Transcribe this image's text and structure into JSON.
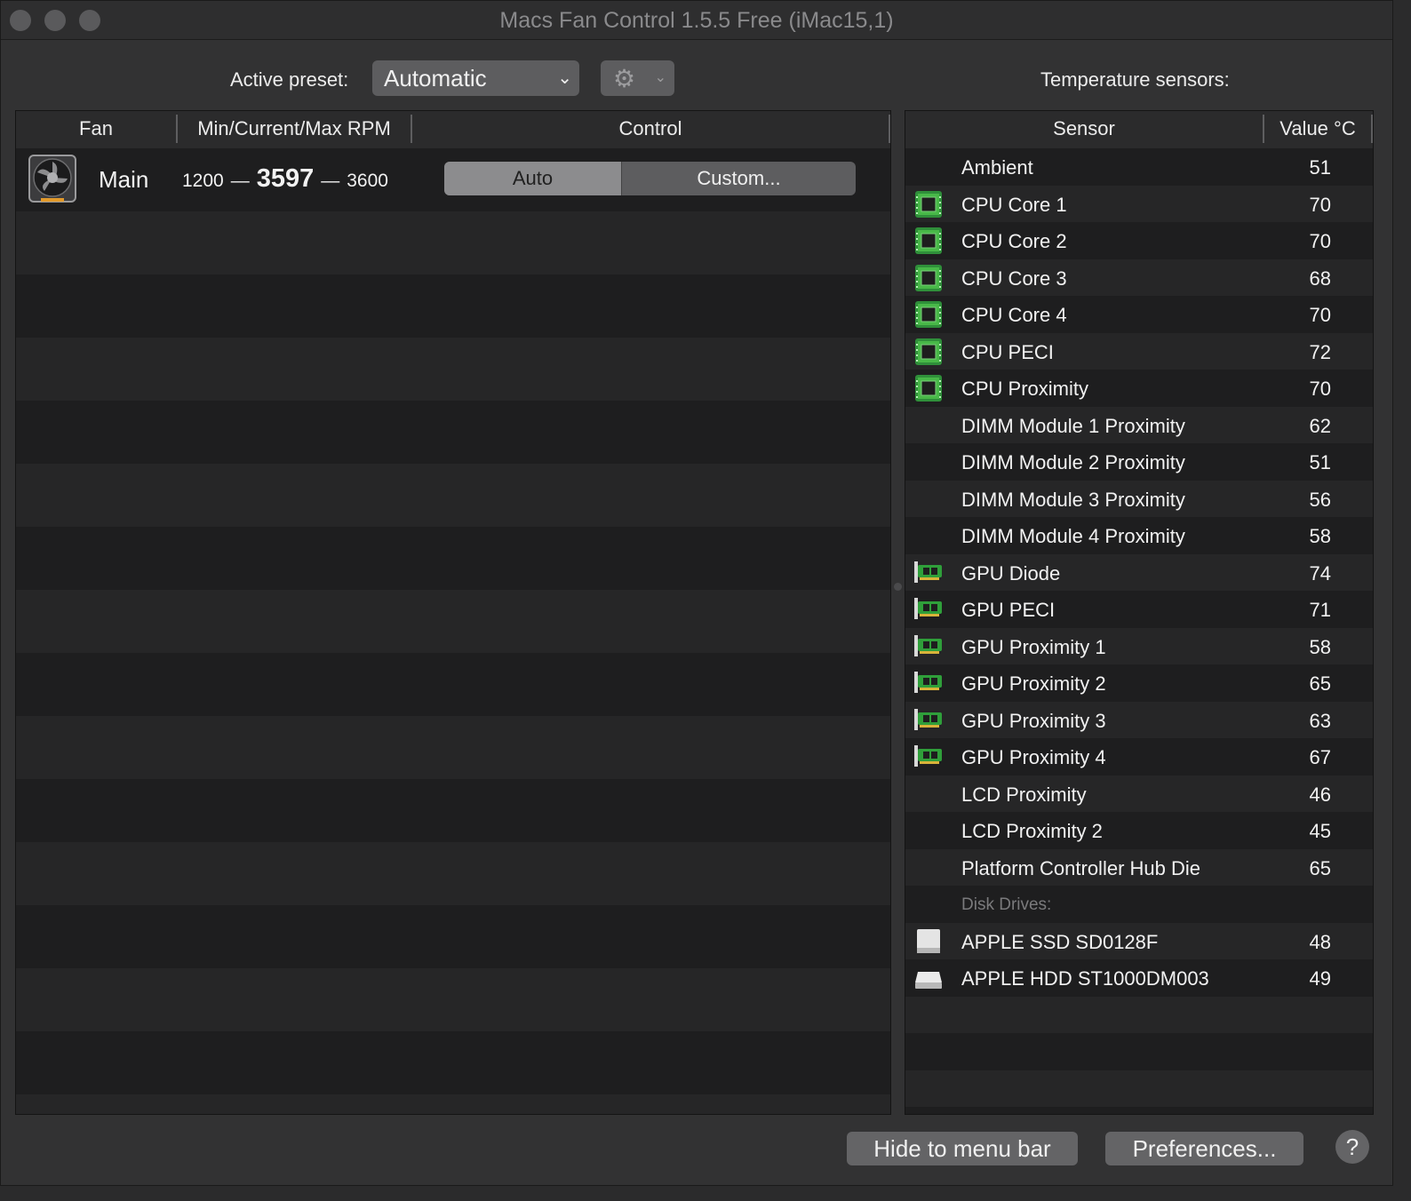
{
  "window": {
    "title": "Macs Fan Control 1.5.5 Free (iMac15,1)"
  },
  "toolbar": {
    "preset_label": "Active preset:",
    "preset_value": "Automatic",
    "sensors_heading": "Temperature sensors:"
  },
  "fans_table": {
    "columns": [
      "Fan",
      "Min/Current/Max RPM",
      "Control"
    ],
    "rows": [
      {
        "name": "Main",
        "min": "1200",
        "current": "3597",
        "max": "3600",
        "auto_label": "Auto",
        "custom_label": "Custom...",
        "selected": "Auto"
      }
    ]
  },
  "sensors_table": {
    "columns": [
      "Sensor",
      "Value °C"
    ],
    "rows": [
      {
        "icon": "none",
        "name": "Ambient",
        "value": "51"
      },
      {
        "icon": "cpu-chip-icon",
        "name": "CPU Core 1",
        "value": "70"
      },
      {
        "icon": "cpu-chip-icon",
        "name": "CPU Core 2",
        "value": "70"
      },
      {
        "icon": "cpu-chip-icon",
        "name": "CPU Core 3",
        "value": "68"
      },
      {
        "icon": "cpu-chip-icon",
        "name": "CPU Core 4",
        "value": "70"
      },
      {
        "icon": "cpu-chip-icon",
        "name": "CPU PECI",
        "value": "72"
      },
      {
        "icon": "cpu-chip-icon",
        "name": "CPU Proximity",
        "value": "70"
      },
      {
        "icon": "none",
        "name": "DIMM Module 1 Proximity",
        "value": "62"
      },
      {
        "icon": "none",
        "name": "DIMM Module 2 Proximity",
        "value": "51"
      },
      {
        "icon": "none",
        "name": "DIMM Module 3 Proximity",
        "value": "56"
      },
      {
        "icon": "none",
        "name": "DIMM Module 4 Proximity",
        "value": "58"
      },
      {
        "icon": "gpu-card-icon",
        "name": "GPU Diode",
        "value": "74"
      },
      {
        "icon": "gpu-card-icon",
        "name": "GPU PECI",
        "value": "71"
      },
      {
        "icon": "gpu-card-icon",
        "name": "GPU Proximity 1",
        "value": "58"
      },
      {
        "icon": "gpu-card-icon",
        "name": "GPU Proximity 2",
        "value": "65"
      },
      {
        "icon": "gpu-card-icon",
        "name": "GPU Proximity 3",
        "value": "63"
      },
      {
        "icon": "gpu-card-icon",
        "name": "GPU Proximity 4",
        "value": "67"
      },
      {
        "icon": "none",
        "name": "LCD Proximity",
        "value": "46"
      },
      {
        "icon": "none",
        "name": "LCD Proximity 2",
        "value": "45"
      },
      {
        "icon": "none",
        "name": "Platform Controller Hub Die",
        "value": "65"
      },
      {
        "icon": "group",
        "name": "Disk Drives:",
        "value": ""
      },
      {
        "icon": "ssd-drive-icon",
        "name": "APPLE SSD SD0128F",
        "value": "48"
      },
      {
        "icon": "hdd-drive-icon",
        "name": "APPLE HDD ST1000DM003",
        "value": "49"
      }
    ]
  },
  "footer": {
    "hide_label": "Hide to menu bar",
    "prefs_label": "Preferences...",
    "help_label": "?"
  }
}
